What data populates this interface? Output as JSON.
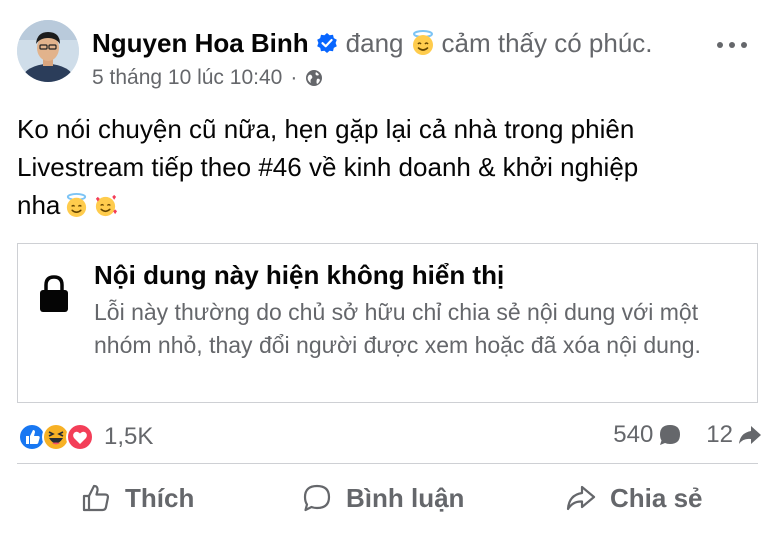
{
  "post": {
    "author": "Nguyen Hoa Binh",
    "feeling_prefix": "đang",
    "feeling_text": "cảm thấy có phúc.",
    "timestamp": "5 tháng 10 lúc 10:40",
    "meta_separator": "·",
    "audience_icon": "globe-icon",
    "verified_icon": "verified-badge-icon",
    "feeling_icon": "smiling-face-with-halo-emoji",
    "body_line1": "Ko nói chuyện cũ nữa, hẹn gặp lại cả nhà trong phiên",
    "body_line2": "Livestream tiếp theo #46 về kinh doanh & khởi nghiệp",
    "body_line3": "nha",
    "body_emojis": [
      "smiling-face-with-halo-emoji",
      "smiling-face-with-hearts-emoji"
    ]
  },
  "unavailable_card": {
    "icon": "lock-icon",
    "title": "Nội dung này hiện không hiển thị",
    "description": "Lỗi này thường do chủ sở hữu chỉ chia sẻ nội dung với một nhóm nhỏ, thay đổi người được xem hoặc đã xóa nội dung."
  },
  "engagement": {
    "reaction_icons": [
      "like-reaction-icon",
      "haha-reaction-icon",
      "love-reaction-icon"
    ],
    "reaction_count": "1,5K",
    "comment_count": "540",
    "share_count": "12"
  },
  "actions": {
    "like_label": "Thích",
    "comment_label": "Bình luận",
    "share_label": "Chia sẻ"
  },
  "colors": {
    "text_primary": "#050505",
    "text_secondary": "#65676b",
    "border": "#ced0d4",
    "verified_blue": "#0866ff",
    "like_blue": "#1877f2",
    "love_red": "#f33e58",
    "haha_yellow": "#f7b125"
  }
}
